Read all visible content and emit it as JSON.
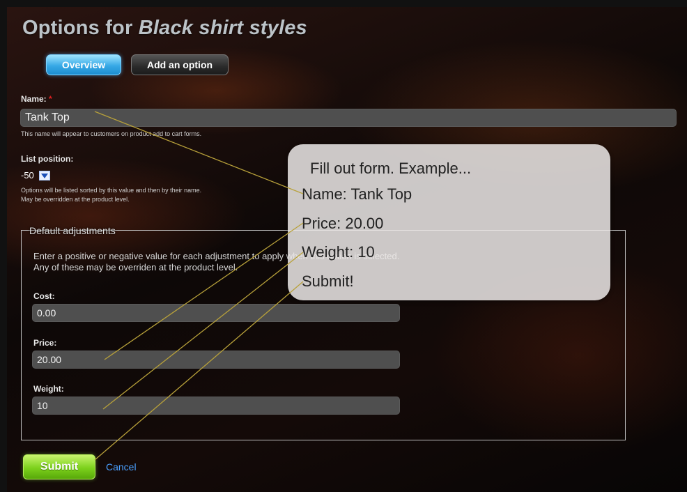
{
  "header": {
    "title_prefix": "Options for ",
    "title_subject": "Black shirt styles"
  },
  "tabs": [
    {
      "label": "Overview",
      "active": true
    },
    {
      "label": "Add an option",
      "active": false
    }
  ],
  "form": {
    "name_label": "Name:",
    "required_mark": "*",
    "name_value": "Tank Top",
    "name_help": "This name will appear to customers on product add to cart forms.",
    "list_position_label": "List position:",
    "list_position_value": "-50",
    "list_position_help_1": "Options will be listed sorted by this value and then by their name.",
    "list_position_help_2": "May be overridden at the product level.",
    "adjustments": {
      "legend": "Default adjustments",
      "intro_1": "Enter a positive or negative value for each adjustment to apply when this option is selected.",
      "intro_2": "Any of these may be overriden at the product level.",
      "cost_label": "Cost:",
      "cost_value": "0.00",
      "price_label": "Price:",
      "price_value": "20.00",
      "weight_label": "Weight:",
      "weight_value": "10"
    },
    "submit_label": "Submit",
    "cancel_label": "Cancel"
  },
  "callout": {
    "title": "Fill out form. Example...",
    "line_name": "Name: Tank Top",
    "line_price": "Price: 20.00",
    "line_weight": "Weight: 10",
    "line_submit": "Submit!"
  },
  "colors": {
    "accent_blue": "#37a9e6",
    "submit_green": "#7cd11c",
    "link_blue": "#4aa0ff",
    "required_red": "#e02020",
    "annotation_line": "#b8a13a"
  },
  "icons": {
    "list_position_dropdown": "chevron-down-icon"
  }
}
